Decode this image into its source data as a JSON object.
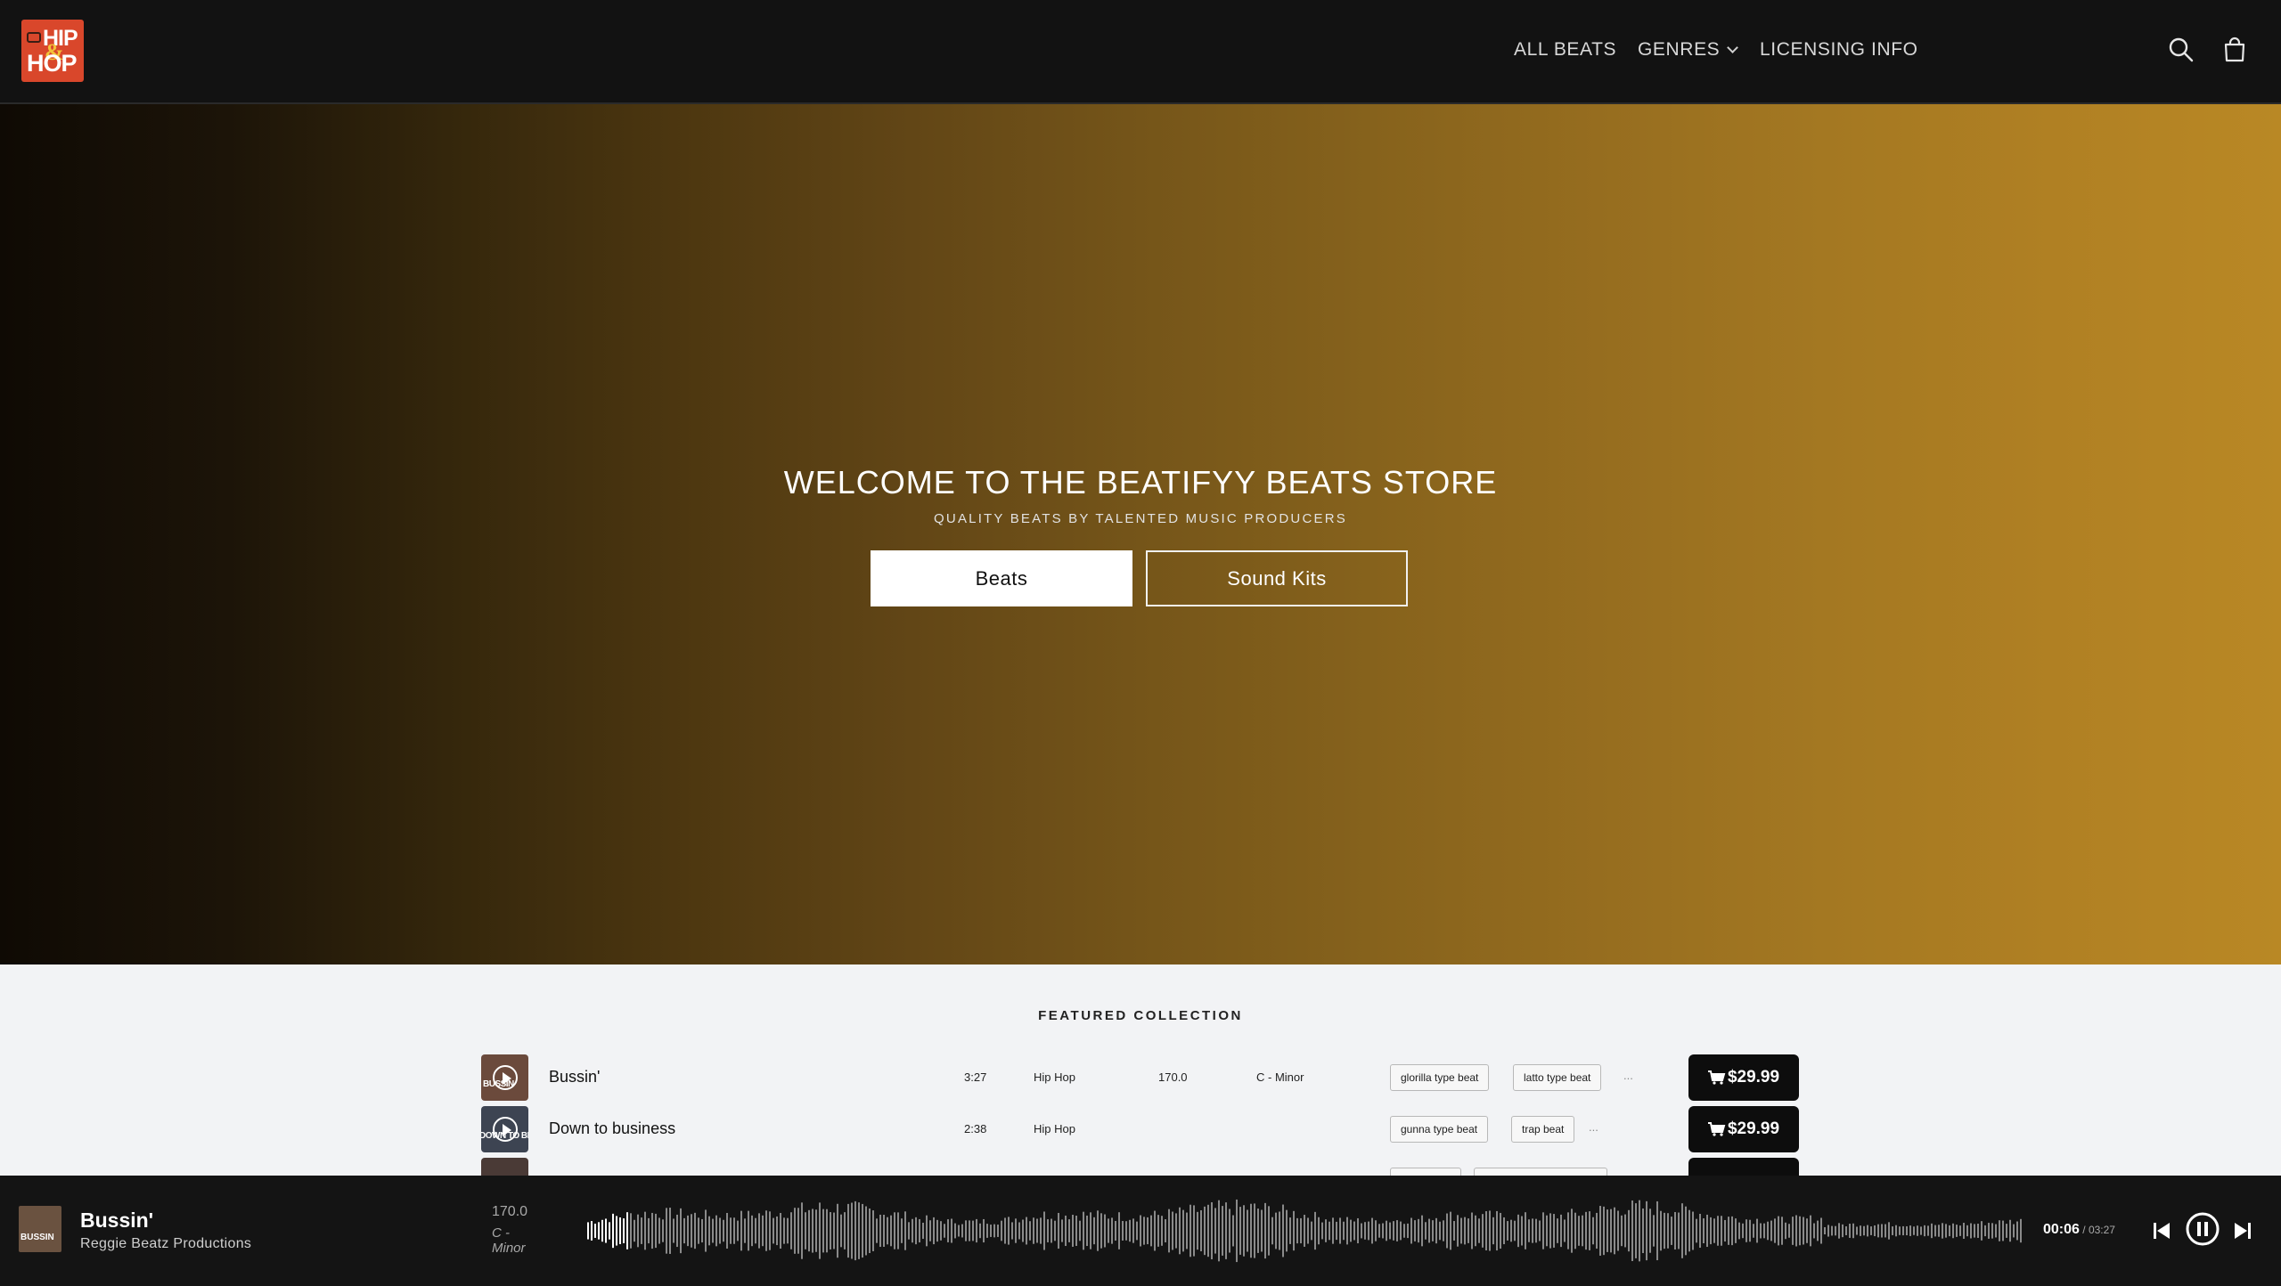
{
  "brand": {
    "logo_line1": "HIP",
    "logo_amp": "&",
    "logo_line2": "HOP"
  },
  "nav": {
    "all_beats": "ALL BEATS",
    "genres": "GENRES",
    "licensing": "LICENSING INFO"
  },
  "icons": {
    "search": "search-icon",
    "cart": "cart-icon"
  },
  "hero": {
    "title": "WELCOME TO THE BEATIFYY BEATS STORE",
    "subtitle": "QUALITY BEATS BY TALENTED MUSIC PRODUCERS",
    "primary_button": "Beats",
    "secondary_button": "Sound Kits"
  },
  "featured": {
    "title": "FEATURED COLLECTION",
    "tracks": [
      {
        "thumb_text": "BUSSIN",
        "name": "Bussin'",
        "duration": "3:27",
        "genre": "Hip Hop",
        "bpm": "170.0",
        "key": "C - Minor",
        "tags": [
          "glorilla type beat",
          "latto type beat"
        ],
        "more": "...",
        "price": "$29.99"
      },
      {
        "thumb_text": "DOWN TO BIZ",
        "name": "Down to business",
        "duration": "2:38",
        "genre": "Hip Hop",
        "bpm": "",
        "key": "",
        "tags": [
          "gunna type beat",
          "trap beat"
        ],
        "more": "...",
        "price": "$29.99"
      }
    ]
  },
  "player": {
    "thumb_text": "BUSSIN",
    "title": "Bussin'",
    "artist": "Reggie Beatz Productions",
    "bpm": "170.0",
    "key": "C - Minor",
    "current_time": "00:06",
    "separator": " / ",
    "total_time": "03:27",
    "progress": 0.03
  },
  "colors": {
    "accent_logo": "#d9472b",
    "hero_gold": "#b98825",
    "button_dark": "#0d0d0d"
  }
}
